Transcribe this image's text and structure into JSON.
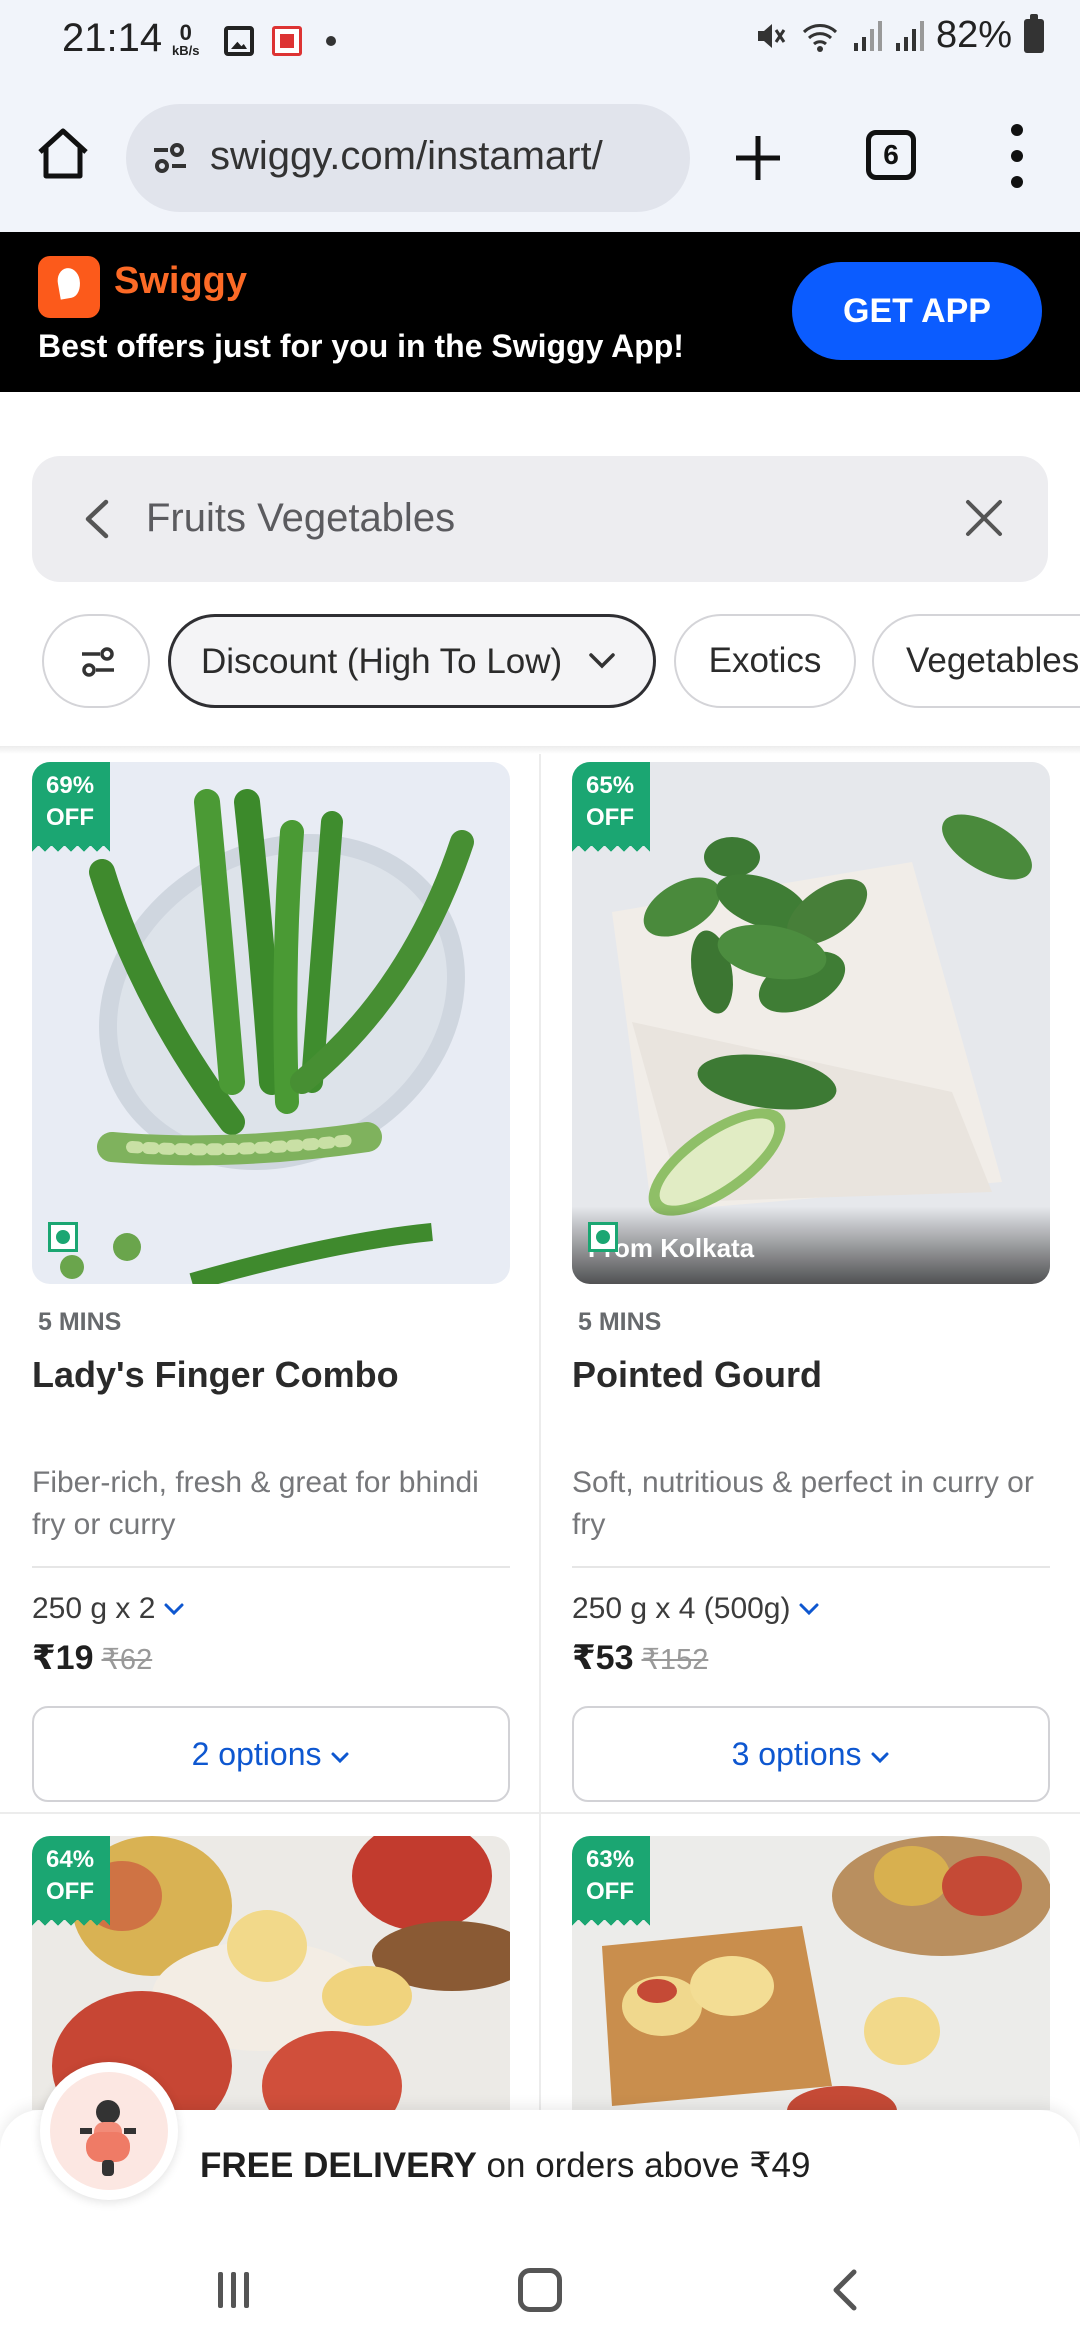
{
  "status_bar": {
    "time": "21:14",
    "net_speed_value": "0",
    "net_speed_unit": "kB/s",
    "battery": "82%"
  },
  "browser": {
    "url": "swiggy.com/instamart/",
    "tab_count": "6"
  },
  "promo": {
    "brand": "Swiggy",
    "text": "Best offers just for you in the Swiggy App!",
    "cta": "GET APP",
    "brand_color": "#fc5a1b",
    "cta_color": "#0b5cff"
  },
  "search": {
    "query": "Fruits Vegetables"
  },
  "filters": {
    "sort_label": "Discount (High To Low)",
    "chips": [
      "Exotics",
      "Vegetables"
    ]
  },
  "products": [
    {
      "discount_pct": "69%",
      "discount_off": "OFF",
      "eta": "5 MINS",
      "name": "Lady's Finger Combo",
      "description": "Fiber-rich, fresh & great for bhindi fry or curry",
      "quantity": "250 g x 2",
      "price": "₹19",
      "mrp": "₹62",
      "options": "2 options"
    },
    {
      "discount_pct": "65%",
      "discount_off": "OFF",
      "origin": "From Kolkata",
      "eta": "5 MINS",
      "name": "Pointed Gourd",
      "description": "Soft, nutritious & perfect in curry or fry",
      "quantity": "250 g x 4 (500g)",
      "price": "₹53",
      "mrp": "₹152",
      "options": "3 options"
    },
    {
      "discount_pct": "64%",
      "discount_off": "OFF"
    },
    {
      "discount_pct": "63%",
      "discount_off": "OFF"
    }
  ],
  "delivery": {
    "bold": "FREE DELIVERY",
    "rest": " on orders above ₹49"
  },
  "colors": {
    "discount_green": "#1ba672",
    "option_blue": "#0e57d0"
  }
}
